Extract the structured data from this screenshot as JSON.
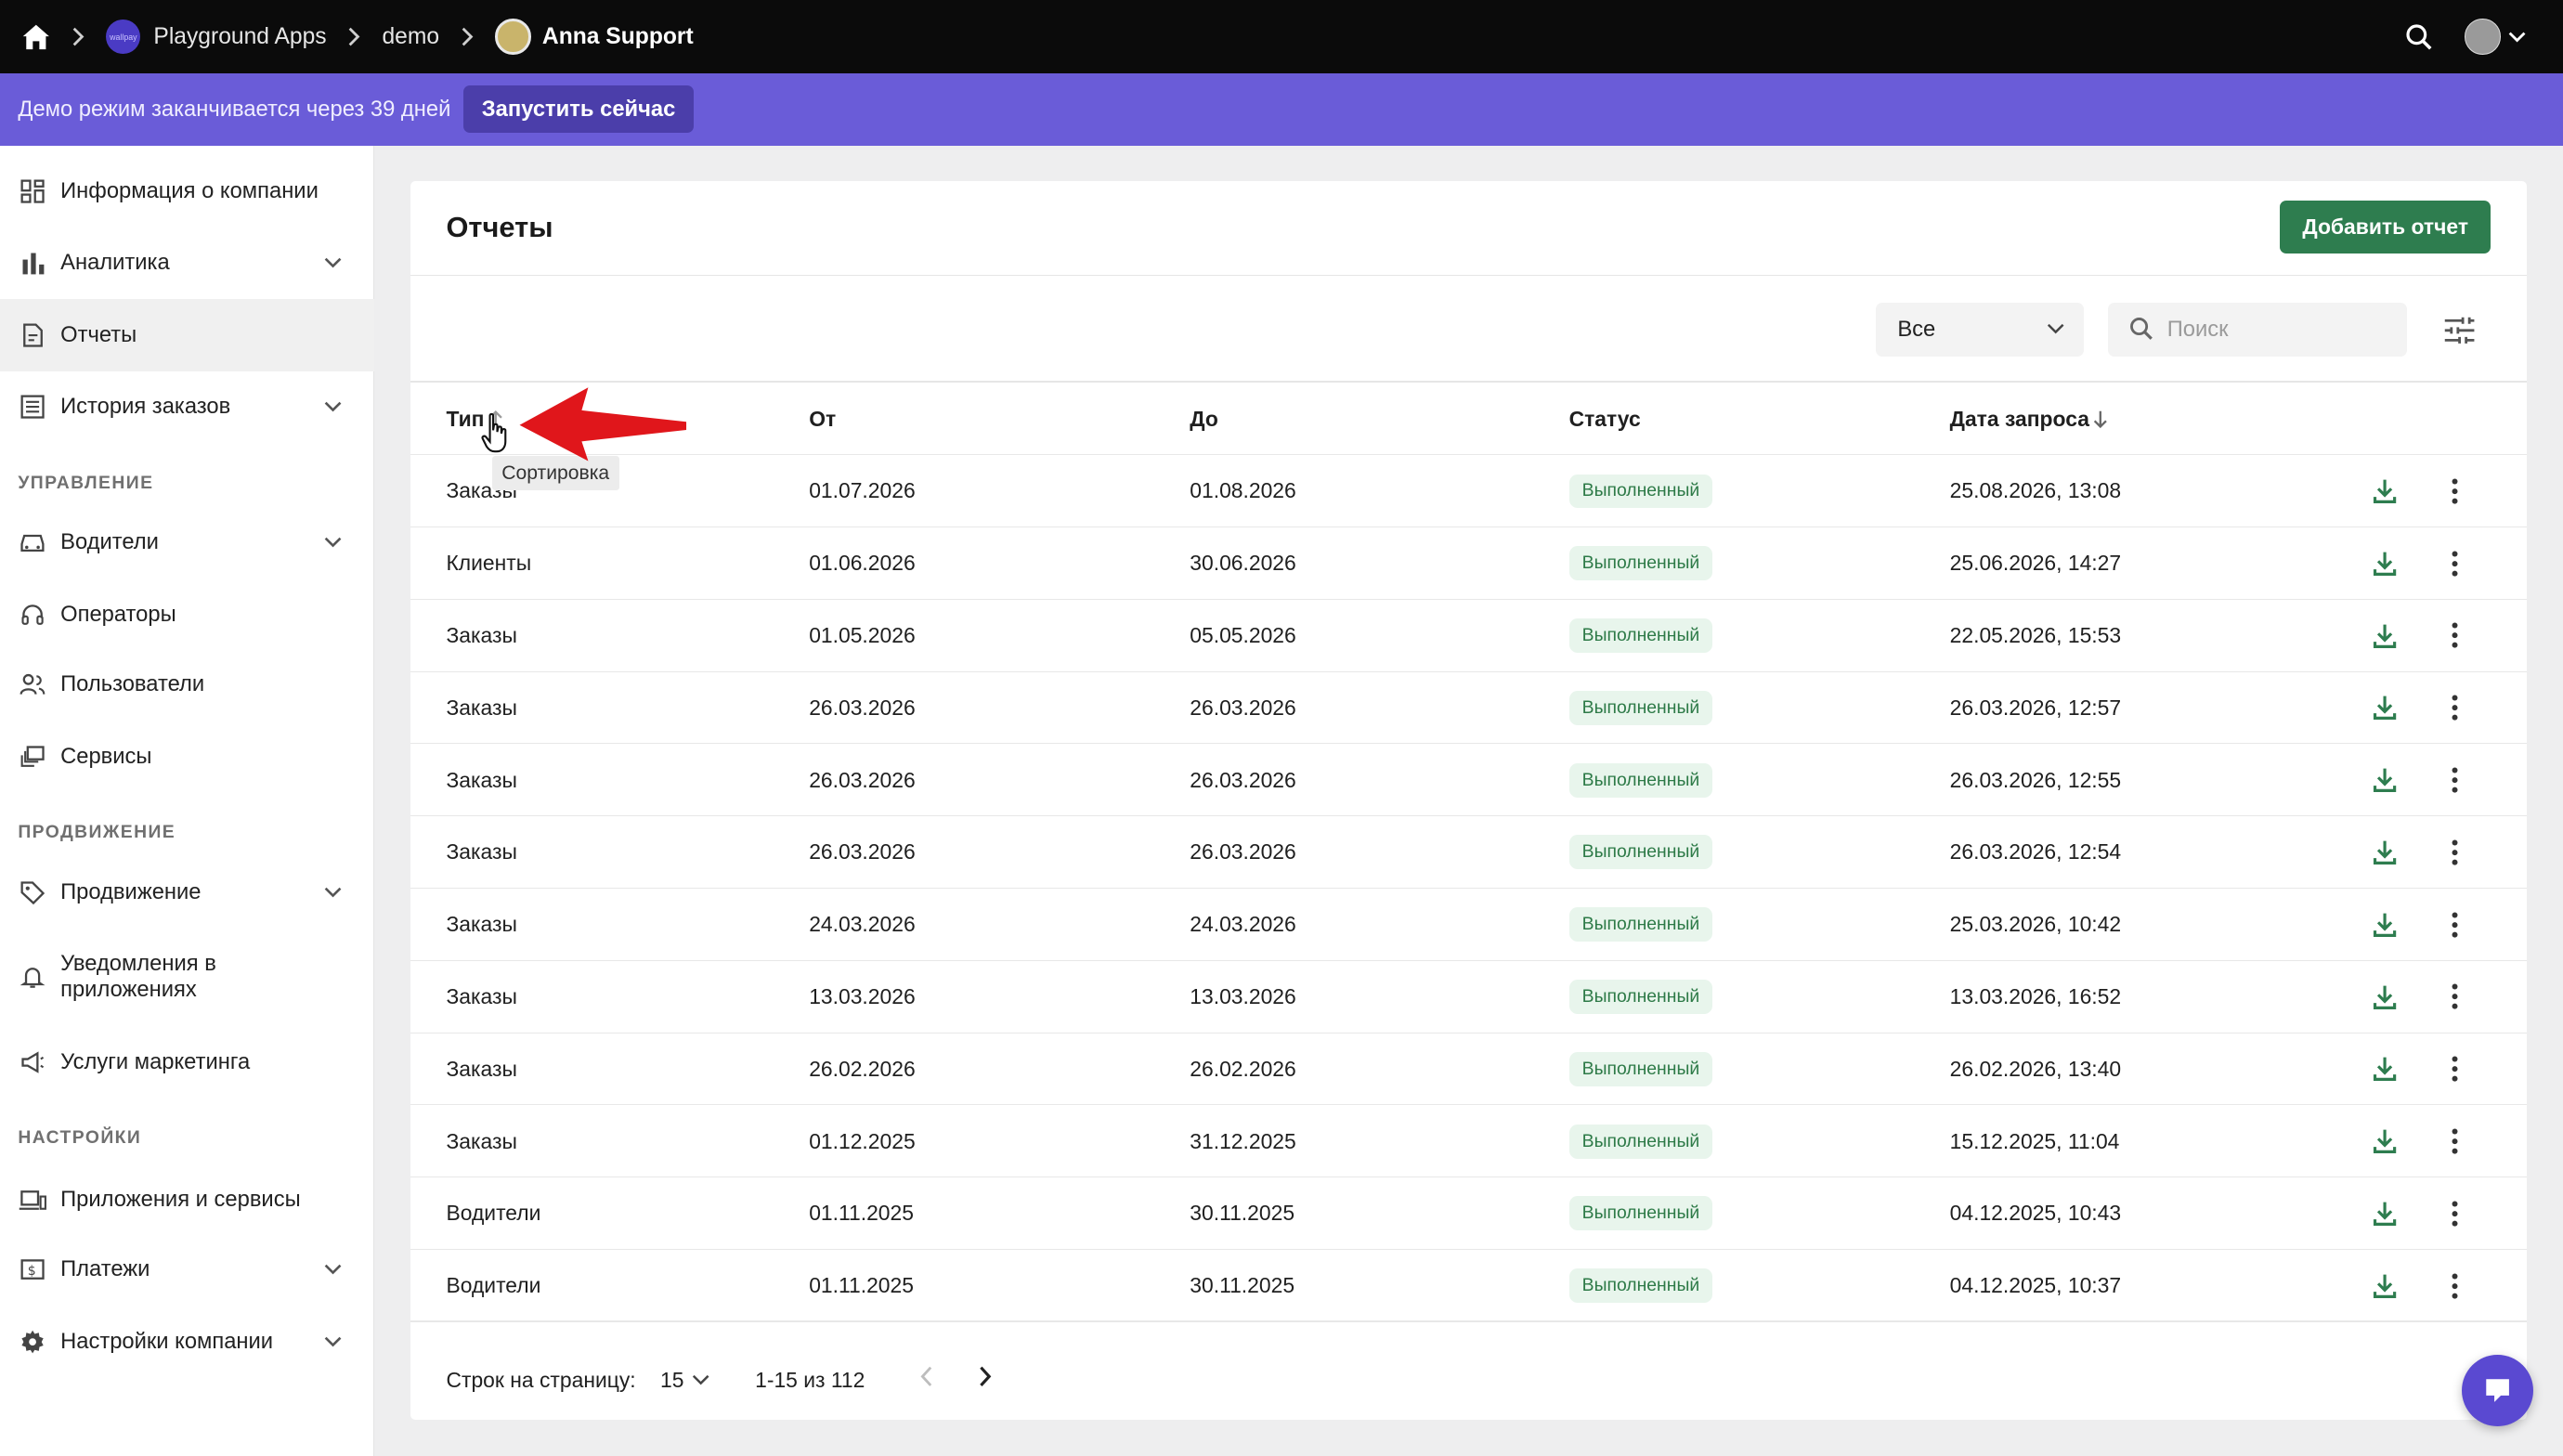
{
  "topbar": {
    "breadcrumbs": [
      {
        "label": "Playground Apps"
      },
      {
        "label": "demo"
      },
      {
        "label": "Anna Support"
      }
    ],
    "logo_text": "wallpay"
  },
  "banner": {
    "message": "Демо режим заканчивается через 39 дней",
    "button": "Запустить сейчас"
  },
  "sidebar": {
    "items": [
      {
        "label": "Информация о компании",
        "icon": "dashboard-icon"
      },
      {
        "label": "Аналитика",
        "icon": "bar-chart-icon"
      },
      {
        "label": "Отчеты",
        "icon": "report-icon"
      },
      {
        "label": "История заказов",
        "icon": "list-icon"
      },
      {
        "label": "Водители",
        "icon": "car-icon"
      },
      {
        "label": "Операторы",
        "icon": "headset-icon"
      },
      {
        "label": "Пользователи",
        "icon": "users-icon"
      },
      {
        "label": "Сервисы",
        "icon": "services-icon"
      },
      {
        "label": "Продвижение",
        "icon": "tag-icon"
      },
      {
        "label": "Уведомления в приложениях",
        "icon": "bell-icon"
      },
      {
        "label": "Услуги маркетинга",
        "icon": "megaphone-icon"
      },
      {
        "label": "Приложения и сервисы",
        "icon": "devices-icon"
      },
      {
        "label": "Платежи",
        "icon": "payment-icon"
      },
      {
        "label": "Настройки компании",
        "icon": "gear-icon"
      }
    ],
    "sections": {
      "manage": "УПРАВЛЕНИЕ",
      "promo": "ПРОДВИЖЕНИЕ",
      "settings": "НАСТРОЙКИ"
    }
  },
  "main": {
    "title": "Отчеты",
    "add_button": "Добавить отчет",
    "filter_value": "Все",
    "search_placeholder": "Поиск",
    "columns": [
      "Тип",
      "От",
      "До",
      "Статус",
      "Дата запроса"
    ],
    "tooltip": "Сортировка",
    "rows": [
      {
        "type": "Заказы",
        "from": "01.07.2026",
        "to": "01.08.2026",
        "status": "Выполненный",
        "requested": "25.08.2026, 13:08"
      },
      {
        "type": "Клиенты",
        "from": "01.06.2026",
        "to": "30.06.2026",
        "status": "Выполненный",
        "requested": "25.06.2026, 14:27"
      },
      {
        "type": "Заказы",
        "from": "01.05.2026",
        "to": "05.05.2026",
        "status": "Выполненный",
        "requested": "22.05.2026, 15:53"
      },
      {
        "type": "Заказы",
        "from": "26.03.2026",
        "to": "26.03.2026",
        "status": "Выполненный",
        "requested": "26.03.2026, 12:57"
      },
      {
        "type": "Заказы",
        "from": "26.03.2026",
        "to": "26.03.2026",
        "status": "Выполненный",
        "requested": "26.03.2026, 12:55"
      },
      {
        "type": "Заказы",
        "from": "26.03.2026",
        "to": "26.03.2026",
        "status": "Выполненный",
        "requested": "26.03.2026, 12:54"
      },
      {
        "type": "Заказы",
        "from": "24.03.2026",
        "to": "24.03.2026",
        "status": "Выполненный",
        "requested": "25.03.2026, 10:42"
      },
      {
        "type": "Заказы",
        "from": "13.03.2026",
        "to": "13.03.2026",
        "status": "Выполненный",
        "requested": "13.03.2026, 16:52"
      },
      {
        "type": "Заказы",
        "from": "26.02.2026",
        "to": "26.02.2026",
        "status": "Выполненный",
        "requested": "26.02.2026, 13:40"
      },
      {
        "type": "Заказы",
        "from": "01.12.2025",
        "to": "31.12.2025",
        "status": "Выполненный",
        "requested": "15.12.2025, 11:04"
      },
      {
        "type": "Водители",
        "from": "01.11.2025",
        "to": "30.11.2025",
        "status": "Выполненный",
        "requested": "04.12.2025, 10:43"
      },
      {
        "type": "Водители",
        "from": "01.11.2025",
        "to": "30.11.2025",
        "status": "Выполненный",
        "requested": "04.12.2025, 10:37"
      }
    ],
    "pagination": {
      "rows_per_page_label": "Строк на страницу:",
      "rows_per_page": "15",
      "range": "1-15 из 112"
    }
  },
  "colors": {
    "topbar": "#0b0b0b",
    "banner": "#6a5cd8",
    "accent_green": "#2e7d4f",
    "badge_bg": "#e8f5ec",
    "annotation_arrow": "#e0161b"
  }
}
